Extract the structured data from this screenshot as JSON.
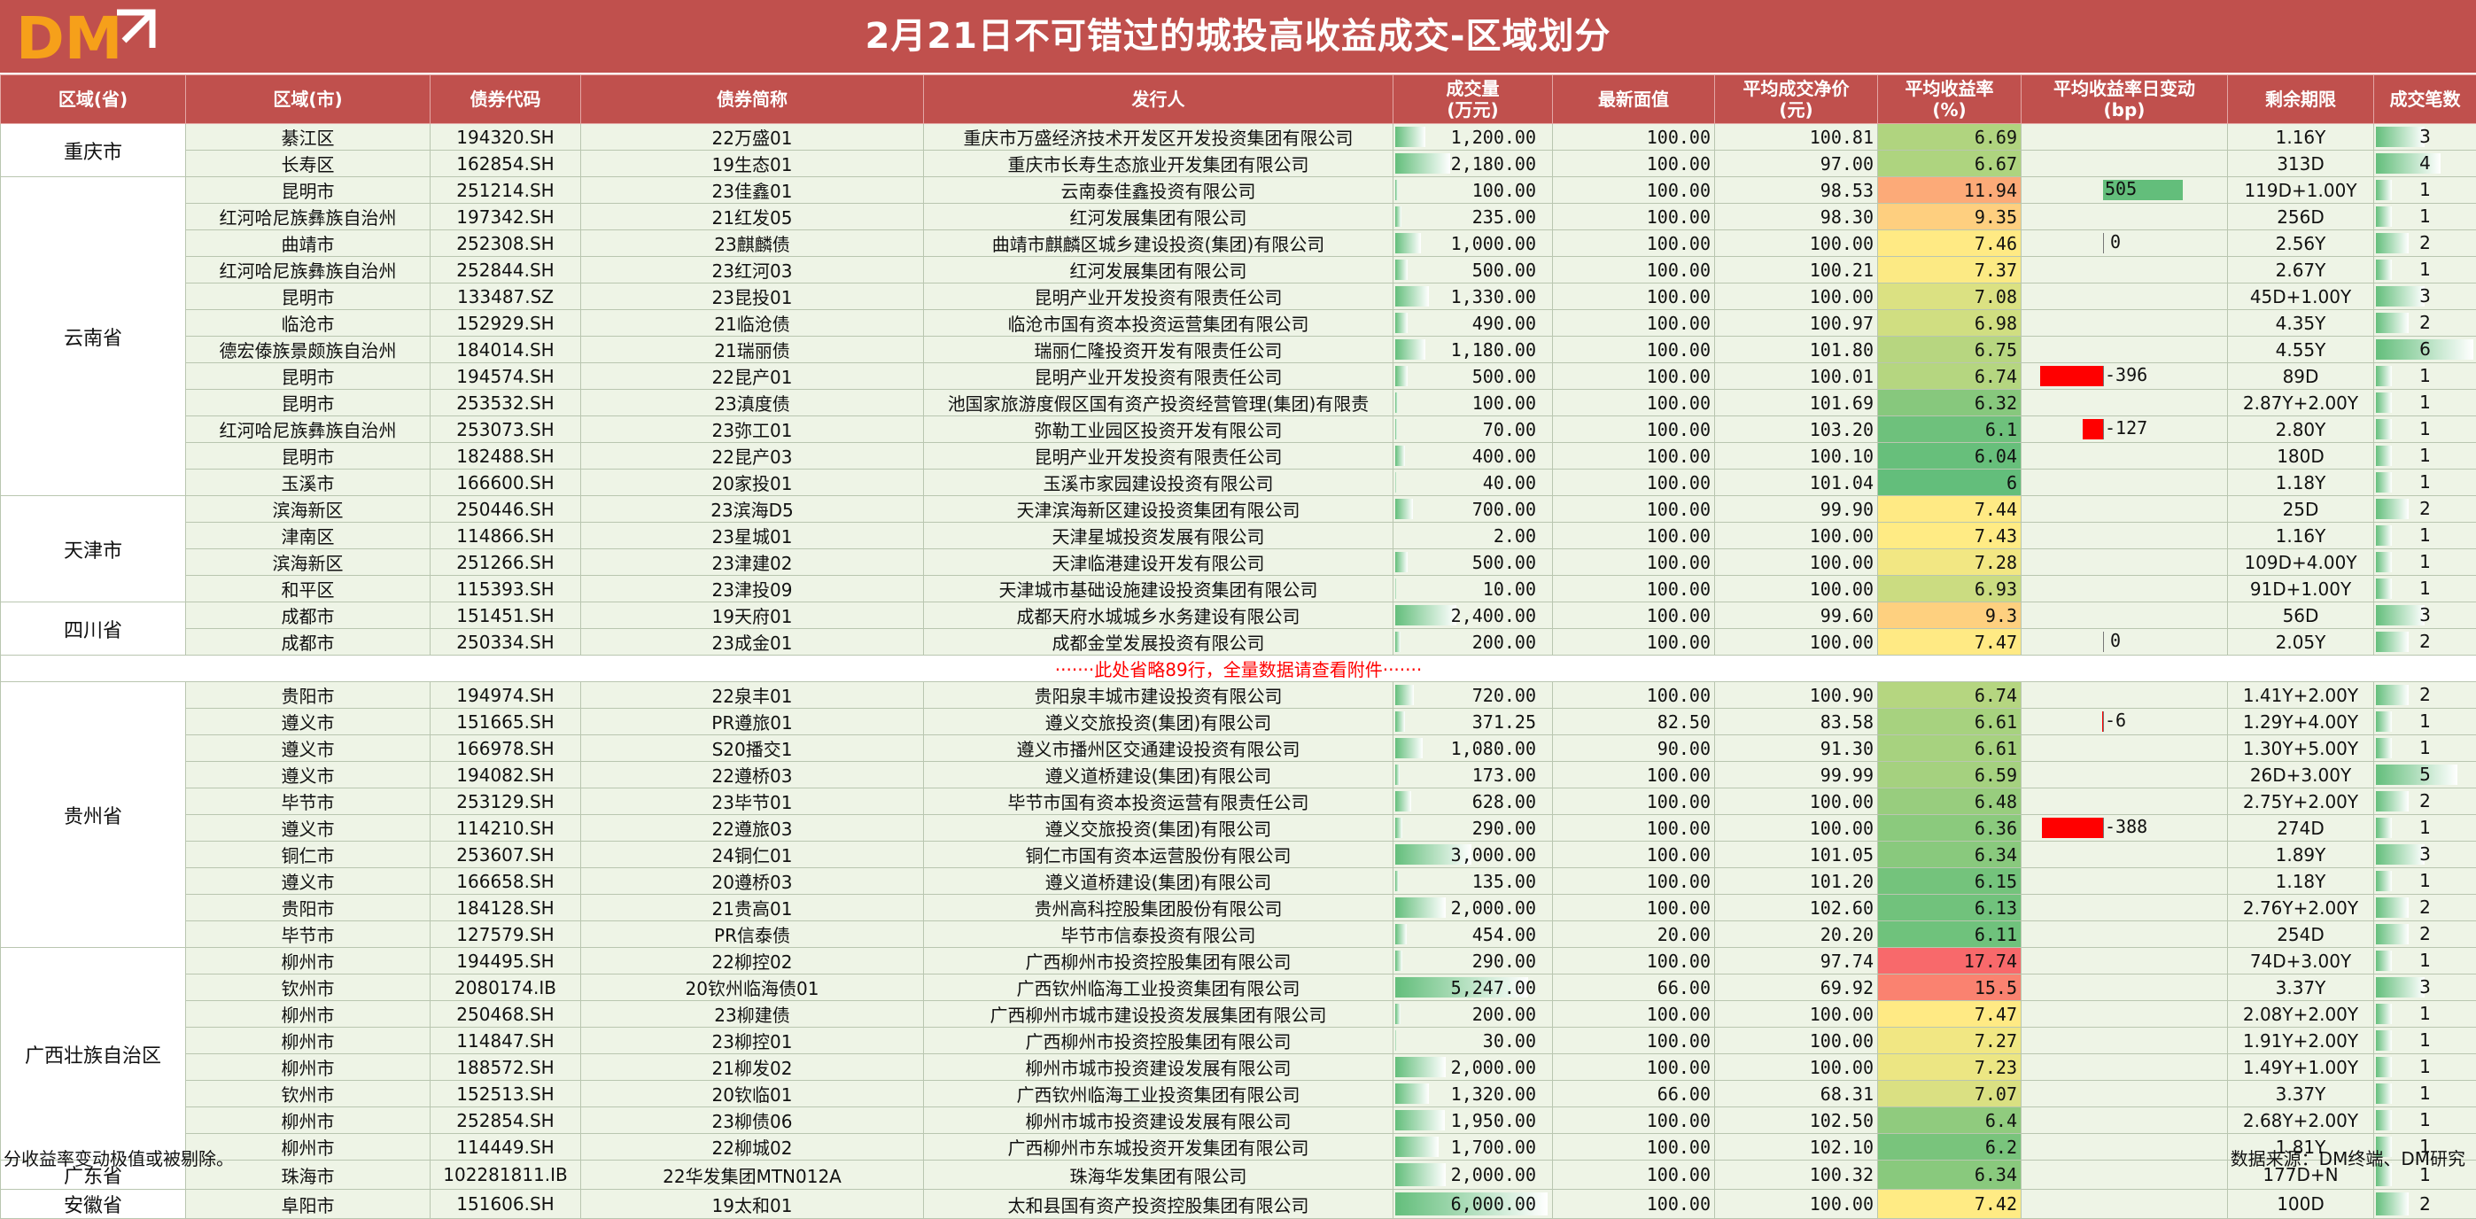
{
  "title": "2月21日不可错过的城投高收益成交-区域划分",
  "logo_text": "DM",
  "colors": {
    "header": "#c0504d",
    "row_bg": "#eef4e6",
    "bar_green": "#63be7b",
    "bar_red": "#ff0000"
  },
  "columns": [
    "区域(省)",
    "区域(市)",
    "债券代码",
    "债券简称",
    "发行人",
    "成交量\n(万元)",
    "最新面值",
    "平均成交净价\n(元)",
    "平均收益率\n(%)",
    "平均收益率日变动\n(bp)",
    "剩余期限",
    "成交笔数"
  ],
  "groups_top": [
    {
      "province": "重庆市",
      "rows": [
        [
          "綦江区",
          "194320.SH",
          "22万盛01",
          "重庆市万盛经济技术开发区开发投资集团有限公司",
          "1,200.00",
          "100.00",
          "100.81",
          "6.69",
          "",
          "1.16Y",
          "3"
        ],
        [
          "长寿区",
          "162854.SH",
          "19生态01",
          "重庆市长寿生态旅业开发集团有限公司",
          "2,180.00",
          "100.00",
          "97.00",
          "6.67",
          "",
          "313D",
          "4"
        ]
      ]
    },
    {
      "province": "云南省",
      "rows": [
        [
          "昆明市",
          "251214.SH",
          "23佳鑫01",
          "云南泰佳鑫投资有限公司",
          "100.00",
          "100.00",
          "98.53",
          "11.94",
          "505",
          "119D+1.00Y",
          "1"
        ],
        [
          "红河哈尼族彝族自治州",
          "197342.SH",
          "21红发05",
          "红河发展集团有限公司",
          "235.00",
          "100.00",
          "98.30",
          "9.35",
          "",
          "256D",
          "1"
        ],
        [
          "曲靖市",
          "252308.SH",
          "23麒麟债",
          "曲靖市麒麟区城乡建设投资(集团)有限公司",
          "1,000.00",
          "100.00",
          "100.00",
          "7.46",
          "0",
          "2.56Y",
          "2"
        ],
        [
          "红河哈尼族彝族自治州",
          "252844.SH",
          "23红河03",
          "红河发展集团有限公司",
          "500.00",
          "100.00",
          "100.21",
          "7.37",
          "",
          "2.67Y",
          "1"
        ],
        [
          "昆明市",
          "133487.SZ",
          "23昆投01",
          "昆明产业开发投资有限责任公司",
          "1,330.00",
          "100.00",
          "100.00",
          "7.08",
          "",
          "45D+1.00Y",
          "3"
        ],
        [
          "临沧市",
          "152929.SH",
          "21临沧债",
          "临沧市国有资本投资运营集团有限公司",
          "490.00",
          "100.00",
          "100.97",
          "6.98",
          "",
          "4.35Y",
          "2"
        ],
        [
          "德宏傣族景颇族自治州",
          "184014.SH",
          "21瑞丽债",
          "瑞丽仁隆投资开发有限责任公司",
          "1,180.00",
          "100.00",
          "101.80",
          "6.75",
          "",
          "4.55Y",
          "6"
        ],
        [
          "昆明市",
          "194574.SH",
          "22昆产01",
          "昆明产业开发投资有限责任公司",
          "500.00",
          "100.00",
          "100.01",
          "6.74",
          "-396",
          "89D",
          "1"
        ],
        [
          "昆明市",
          "253532.SH",
          "23滇度债",
          "池国家旅游度假区国有资产投资经营管理(集团)有限责",
          "100.00",
          "100.00",
          "101.69",
          "6.32",
          "",
          "2.87Y+2.00Y",
          "1"
        ],
        [
          "红河哈尼族彝族自治州",
          "253073.SH",
          "23弥工01",
          "弥勒工业园区投资开发有限公司",
          "70.00",
          "100.00",
          "103.20",
          "6.1",
          "-127",
          "2.80Y",
          "1"
        ],
        [
          "昆明市",
          "182488.SH",
          "22昆产03",
          "昆明产业开发投资有限责任公司",
          "400.00",
          "100.00",
          "100.10",
          "6.04",
          "",
          "180D",
          "1"
        ],
        [
          "玉溪市",
          "166600.SH",
          "20家投01",
          "玉溪市家园建设投资有限公司",
          "40.00",
          "100.00",
          "101.04",
          "6",
          "",
          "1.18Y",
          "1"
        ]
      ]
    },
    {
      "province": "天津市",
      "rows": [
        [
          "滨海新区",
          "250446.SH",
          "23滨海D5",
          "天津滨海新区建设投资集团有限公司",
          "700.00",
          "100.00",
          "99.90",
          "7.44",
          "",
          "25D",
          "2"
        ],
        [
          "津南区",
          "114866.SH",
          "23星城01",
          "天津星城投资发展有限公司",
          "2.00",
          "100.00",
          "100.00",
          "7.43",
          "",
          "1.16Y",
          "1"
        ],
        [
          "滨海新区",
          "251266.SH",
          "23津建02",
          "天津临港建设开发有限公司",
          "500.00",
          "100.00",
          "100.00",
          "7.28",
          "",
          "109D+4.00Y",
          "1"
        ],
        [
          "和平区",
          "115393.SH",
          "23津投09",
          "天津城市基础设施建设投资集团有限公司",
          "10.00",
          "100.00",
          "100.00",
          "6.93",
          "",
          "91D+1.00Y",
          "1"
        ]
      ]
    },
    {
      "province": "四川省",
      "rows": [
        [
          "成都市",
          "151451.SH",
          "19天府01",
          "成都天府水城城乡水务建设有限公司",
          "2,400.00",
          "100.00",
          "99.60",
          "9.3",
          "",
          "56D",
          "3"
        ],
        [
          "成都市",
          "250334.SH",
          "23成金01",
          "成都金堂发展投资有限公司",
          "200.00",
          "100.00",
          "100.00",
          "7.47",
          "0",
          "2.05Y",
          "2"
        ]
      ]
    }
  ],
  "omit_note": "·······此处省略89行，全量数据请查看附件·······",
  "groups_bottom": [
    {
      "province": "贵州省",
      "rows": [
        [
          "贵阳市",
          "194974.SH",
          "22泉丰01",
          "贵阳泉丰城市建设投资有限公司",
          "720.00",
          "100.00",
          "100.90",
          "6.74",
          "",
          "1.41Y+2.00Y",
          "2"
        ],
        [
          "遵义市",
          "151665.SH",
          "PR遵旅01",
          "遵义交旅投资(集团)有限公司",
          "371.25",
          "82.50",
          "83.58",
          "6.61",
          "-6",
          "1.29Y+4.00Y",
          "1"
        ],
        [
          "遵义市",
          "166978.SH",
          "S20播交1",
          "遵义市播州区交通建设投资有限公司",
          "1,080.00",
          "90.00",
          "91.30",
          "6.61",
          "",
          "1.30Y+5.00Y",
          "1"
        ],
        [
          "遵义市",
          "194082.SH",
          "22遵桥03",
          "遵义道桥建设(集团)有限公司",
          "173.00",
          "100.00",
          "99.99",
          "6.59",
          "",
          "26D+3.00Y",
          "5"
        ],
        [
          "毕节市",
          "253129.SH",
          "23毕节01",
          "毕节市国有资本投资运营有限责任公司",
          "628.00",
          "100.00",
          "100.00",
          "6.48",
          "",
          "2.75Y+2.00Y",
          "2"
        ],
        [
          "遵义市",
          "114210.SH",
          "22遵旅03",
          "遵义交旅投资(集团)有限公司",
          "290.00",
          "100.00",
          "100.00",
          "6.36",
          "-388",
          "274D",
          "1"
        ],
        [
          "铜仁市",
          "253607.SH",
          "24铜仁01",
          "铜仁市国有资本运营股份有限公司",
          "3,000.00",
          "100.00",
          "101.05",
          "6.34",
          "",
          "1.89Y",
          "3"
        ],
        [
          "遵义市",
          "166658.SH",
          "20遵桥03",
          "遵义道桥建设(集团)有限公司",
          "135.00",
          "100.00",
          "101.20",
          "6.15",
          "",
          "1.18Y",
          "1"
        ],
        [
          "贵阳市",
          "184128.SH",
          "21贵高01",
          "贵州高科控股集团股份有限公司",
          "2,000.00",
          "100.00",
          "102.60",
          "6.13",
          "",
          "2.76Y+2.00Y",
          "2"
        ],
        [
          "毕节市",
          "127579.SH",
          "PR信泰债",
          "毕节市信泰投资有限公司",
          "454.00",
          "20.00",
          "20.20",
          "6.11",
          "",
          "254D",
          "2"
        ]
      ]
    },
    {
      "province": "广西壮族自治区",
      "rows": [
        [
          "柳州市",
          "194495.SH",
          "22柳控02",
          "广西柳州市投资控股集团有限公司",
          "290.00",
          "100.00",
          "97.74",
          "17.74",
          "",
          "74D+3.00Y",
          "1"
        ],
        [
          "钦州市",
          "2080174.IB",
          "20钦州临海债01",
          "广西钦州临海工业投资集团有限公司",
          "5,247.00",
          "66.00",
          "69.92",
          "15.5",
          "",
          "3.37Y",
          "3"
        ],
        [
          "柳州市",
          "250468.SH",
          "23柳建债",
          "广西柳州市城市建设投资发展集团有限公司",
          "200.00",
          "100.00",
          "100.00",
          "7.47",
          "",
          "2.08Y+2.00Y",
          "1"
        ],
        [
          "柳州市",
          "114847.SH",
          "23柳控01",
          "广西柳州市投资控股集团有限公司",
          "30.00",
          "100.00",
          "100.00",
          "7.27",
          "",
          "1.91Y+2.00Y",
          "1"
        ],
        [
          "柳州市",
          "188572.SH",
          "21柳发02",
          "柳州市城市投资建设发展有限公司",
          "2,000.00",
          "100.00",
          "100.00",
          "7.23",
          "",
          "1.49Y+1.00Y",
          "1"
        ],
        [
          "钦州市",
          "152513.SH",
          "20钦临01",
          "广西钦州临海工业投资集团有限公司",
          "1,320.00",
          "66.00",
          "68.31",
          "7.07",
          "",
          "3.37Y",
          "1"
        ],
        [
          "柳州市",
          "252854.SH",
          "23柳债06",
          "柳州市城市投资建设发展有限公司",
          "1,950.00",
          "100.00",
          "102.50",
          "6.4",
          "",
          "2.68Y+2.00Y",
          "1"
        ],
        [
          "柳州市",
          "114449.SH",
          "22柳城02",
          "广西柳州市东城投资开发集团有限公司",
          "1,700.00",
          "100.00",
          "102.10",
          "6.2",
          "",
          "1.81Y",
          "1"
        ]
      ]
    },
    {
      "province": "广东省",
      "rows": [
        [
          "珠海市",
          "102281811.IB",
          "22华发集团MTN012A",
          "珠海华发集团有限公司",
          "2,000.00",
          "100.00",
          "100.32",
          "6.34",
          "",
          "177D+N",
          "1"
        ]
      ]
    },
    {
      "province": "安徽省",
      "rows": [
        [
          "阜阳市",
          "151606.SH",
          "19太和01",
          "太和县国有资产投资控股集团有限公司",
          "6,000.00",
          "100.00",
          "100.00",
          "7.42",
          "",
          "100D",
          "2"
        ]
      ]
    }
  ],
  "footer_left": "分收益率变动极值或被剔除。",
  "footer_right": "数据来源：DM终端、DM研究"
}
